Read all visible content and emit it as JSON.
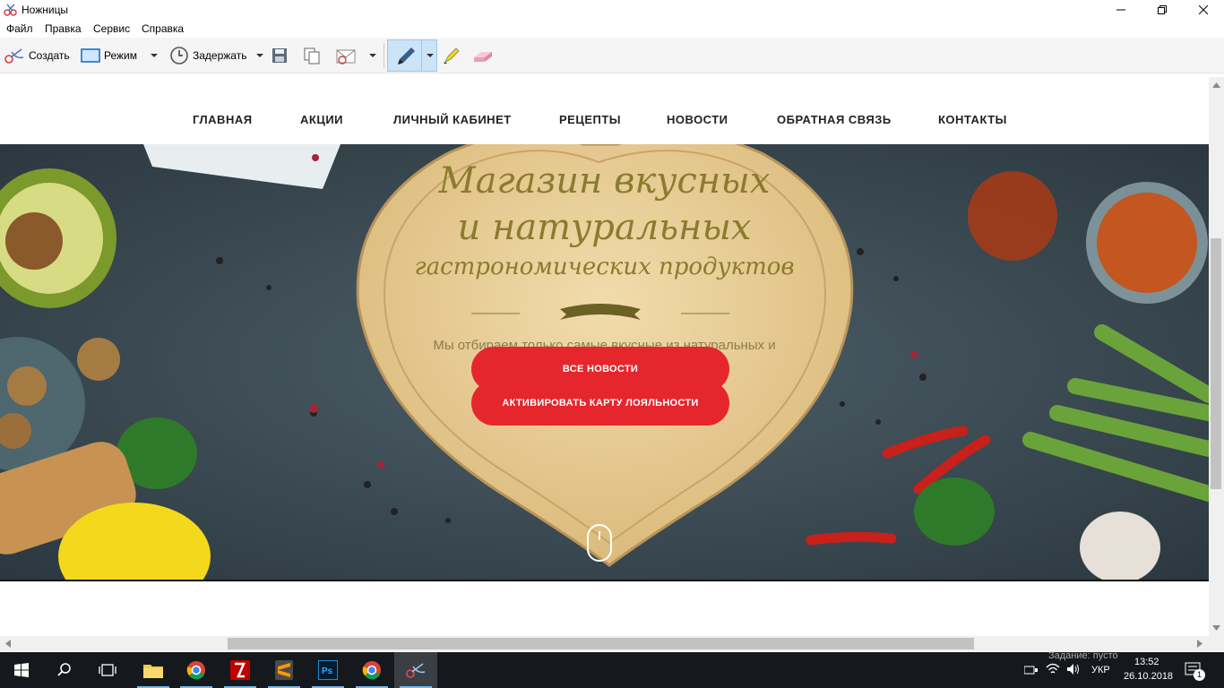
{
  "window": {
    "title": "Ножницы"
  },
  "menu": [
    "Файл",
    "Правка",
    "Сервис",
    "Справка"
  ],
  "toolbar": {
    "new_label": "Создать",
    "mode_label": "Режим",
    "delay_label": "Задержать"
  },
  "site": {
    "nav": [
      "ГЛАВНАЯ",
      "АКЦИИ",
      "ЛИЧНЫЙ КАБИНЕТ",
      "РЕЦЕПТЫ",
      "НОВОСТИ",
      "ОБРАТНАЯ СВЯЗЬ",
      "КОНТАКТЫ"
    ],
    "hero": {
      "line1": "Магазин вкусных",
      "line2": "и натуральных",
      "line3": "гастрономических продуктов",
      "subtitle": "Мы отбираем только самые вкусные из натуральных и",
      "button_news": "ВСЕ НОВОСТИ",
      "button_card": "АКТИВИРОВАТЬ КАРТУ ЛОЯЛЬНОСТИ"
    }
  },
  "taskbar": {
    "apps": [
      "file-explorer-icon",
      "chrome-icon",
      "filezilla-icon",
      "sublime-icon",
      "photoshop-icon",
      "chrome-icon",
      "snipping-tool-icon"
    ],
    "background_text": "Задание: пусто",
    "language": "УКР",
    "time": "13:52",
    "date": "26.10.2018",
    "notifications": "1"
  },
  "colors": {
    "accent_red": "#e6262d",
    "hero_text": "#8a7b2e",
    "taskbar": "#15191d",
    "selected_tool": "#cce4f7"
  }
}
